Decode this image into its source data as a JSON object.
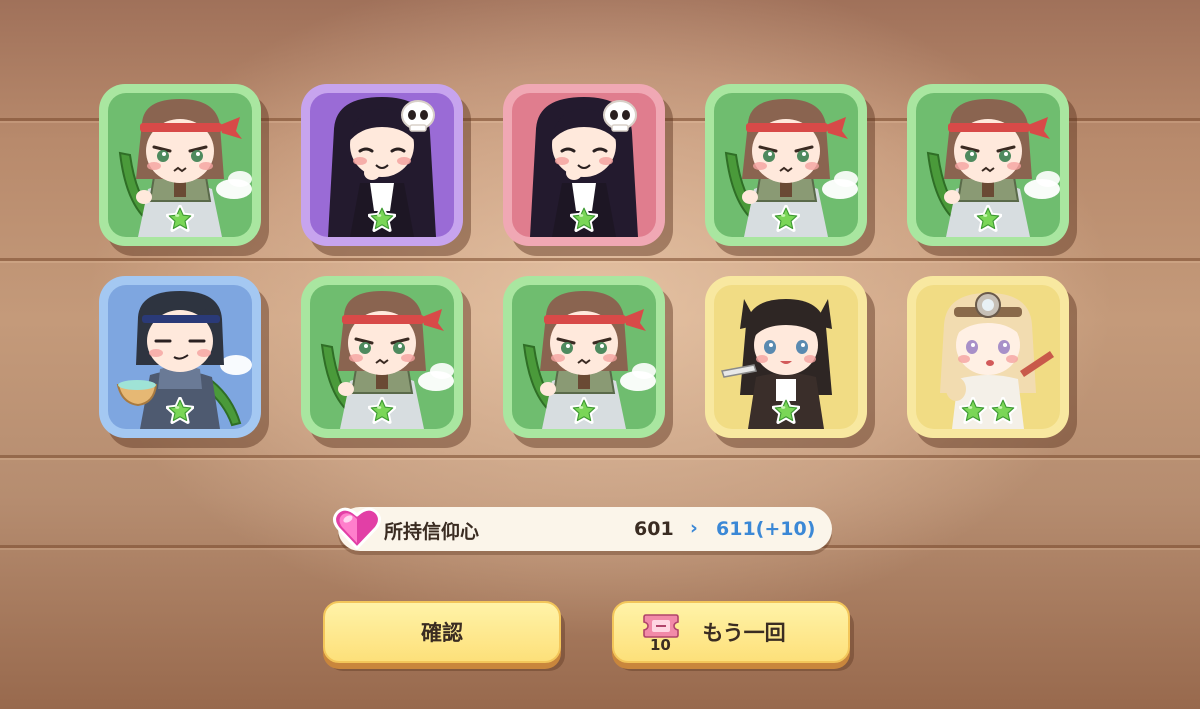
{
  "results": [
    {
      "character": "headband-girl-cucumber",
      "frame": "green",
      "stars": 1
    },
    {
      "character": "skull-hair-girl",
      "frame": "purple",
      "stars": 1
    },
    {
      "character": "skull-hair-girl",
      "frame": "pink",
      "stars": 1
    },
    {
      "character": "headband-girl-cucumber",
      "frame": "green",
      "stars": 1
    },
    {
      "character": "headband-girl-cucumber",
      "frame": "green",
      "stars": 1
    },
    {
      "character": "dark-hair-headband-girl-bowl",
      "frame": "blue",
      "stars": 1
    },
    {
      "character": "headband-girl-cucumber",
      "frame": "green",
      "stars": 1
    },
    {
      "character": "headband-girl-cucumber",
      "frame": "green",
      "stars": 1
    },
    {
      "character": "wolf-ear-girl",
      "frame": "yellow",
      "stars": 1
    },
    {
      "character": "goggles-blonde-girl",
      "frame": "yellow",
      "stars": 2
    }
  ],
  "faith": {
    "label": "所持信仰心",
    "current": "601",
    "arrow": "›",
    "new_value": "611(+10)"
  },
  "buttons": {
    "confirm_label": "確認",
    "again_label": "もう一回",
    "ticket_count": "10"
  },
  "colors": {
    "frame_green": "#6fbd6f",
    "frame_purple": "#9a6bd6",
    "frame_pink": "#e07d8e",
    "frame_blue": "#7ea6e0",
    "frame_yellow": "#f1dc84",
    "star_green": "#7ad657",
    "button_yellow": "#fde07a",
    "faith_blue": "#3b88d6"
  },
  "icons": {
    "faith": "heart-gem-icon",
    "ticket": "gacha-ticket-icon",
    "star": "star-icon"
  }
}
